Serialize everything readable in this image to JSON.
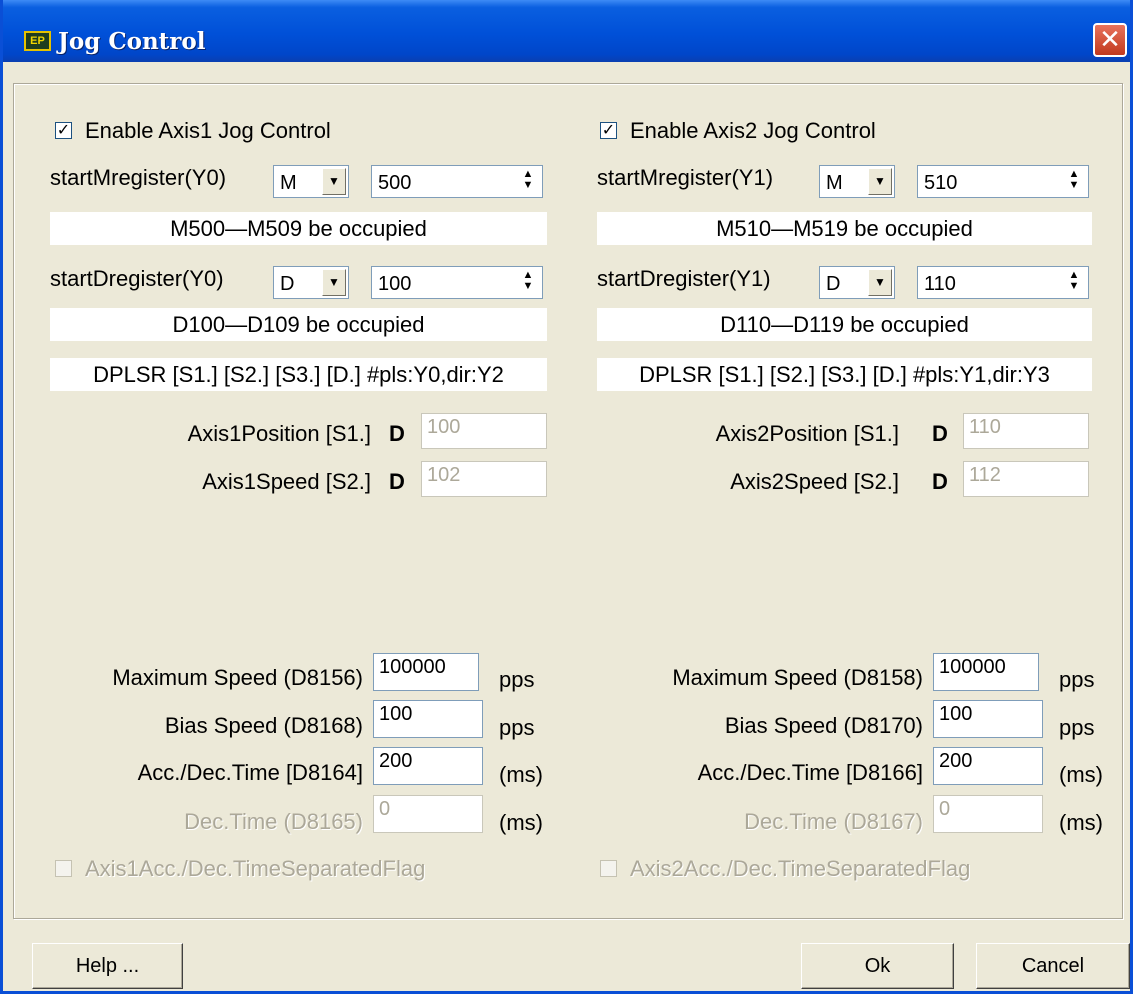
{
  "window": {
    "title": "Jog Control",
    "icon_text": "EP",
    "close_glyph": "✕"
  },
  "axis1": {
    "enable_label": "Enable Axis1 Jog Control",
    "enable_checked": true,
    "start_m_label": "startMregister(Y0)",
    "start_m_type": "M",
    "start_m_value": "500",
    "m_occupied": "M500—M509 be occupied",
    "start_d_label": "startDregister(Y0)",
    "start_d_type": "D",
    "start_d_value": "100",
    "d_occupied": "D100—D109 be occupied",
    "instruction": "DPLSR [S1.] [S2.] [S3.] [D.] #pls:Y0,dir:Y2",
    "position_label": "Axis1Position [S1.]",
    "position_prefix": "D",
    "position_value": "100",
    "speed_label": "Axis1Speed [S2.]",
    "speed_prefix": "D",
    "speed_value": "102",
    "max_speed_label": "Maximum Speed (D8156)",
    "max_speed_value": "100000",
    "max_speed_unit": "pps",
    "bias_speed_label": "Bias Speed (D8168)",
    "bias_speed_value": "100",
    "bias_speed_unit": "pps",
    "acc_label": "Acc./Dec.Time [D8164]",
    "acc_value": "200",
    "acc_unit": "(ms)",
    "dec_label": "Dec.Time (D8165)",
    "dec_value": "0",
    "dec_unit": "(ms)",
    "separated_label": "Axis1Acc./Dec.TimeSeparatedFlag"
  },
  "axis2": {
    "enable_label": "Enable Axis2 Jog Control",
    "enable_checked": true,
    "start_m_label": "startMregister(Y1)",
    "start_m_type": "M",
    "start_m_value": "510",
    "m_occupied": "M510—M519 be occupied",
    "start_d_label": "startDregister(Y1)",
    "start_d_type": "D",
    "start_d_value": "110",
    "d_occupied": "D110—D119 be occupied",
    "instruction": "DPLSR [S1.] [S2.] [S3.] [D.] #pls:Y1,dir:Y3",
    "position_label": "Axis2Position [S1.]",
    "position_prefix": "D",
    "position_value": "110",
    "speed_label": "Axis2Speed [S2.]",
    "speed_prefix": "D",
    "speed_value": "112",
    "max_speed_label": "Maximum Speed (D8158)",
    "max_speed_value": "100000",
    "max_speed_unit": "pps",
    "bias_speed_label": "Bias Speed (D8170)",
    "bias_speed_value": "100",
    "bias_speed_unit": "pps",
    "acc_label": "Acc./Dec.Time [D8166]",
    "acc_value": "200",
    "acc_unit": "(ms)",
    "dec_label": "Dec.Time (D8167)",
    "dec_value": "0",
    "dec_unit": "(ms)",
    "separated_label": "Axis2Acc./Dec.TimeSeparatedFlag"
  },
  "buttons": {
    "help": "Help ...",
    "ok": "Ok",
    "cancel": "Cancel"
  },
  "glyphs": {
    "check": "✓",
    "dropdown": "▼",
    "spin_up": "▲",
    "spin_down": "▼"
  },
  "colors": {
    "title_bar": "#0050d8",
    "dialog_bg": "#ece9d8",
    "disabled_text": "#aca899"
  }
}
